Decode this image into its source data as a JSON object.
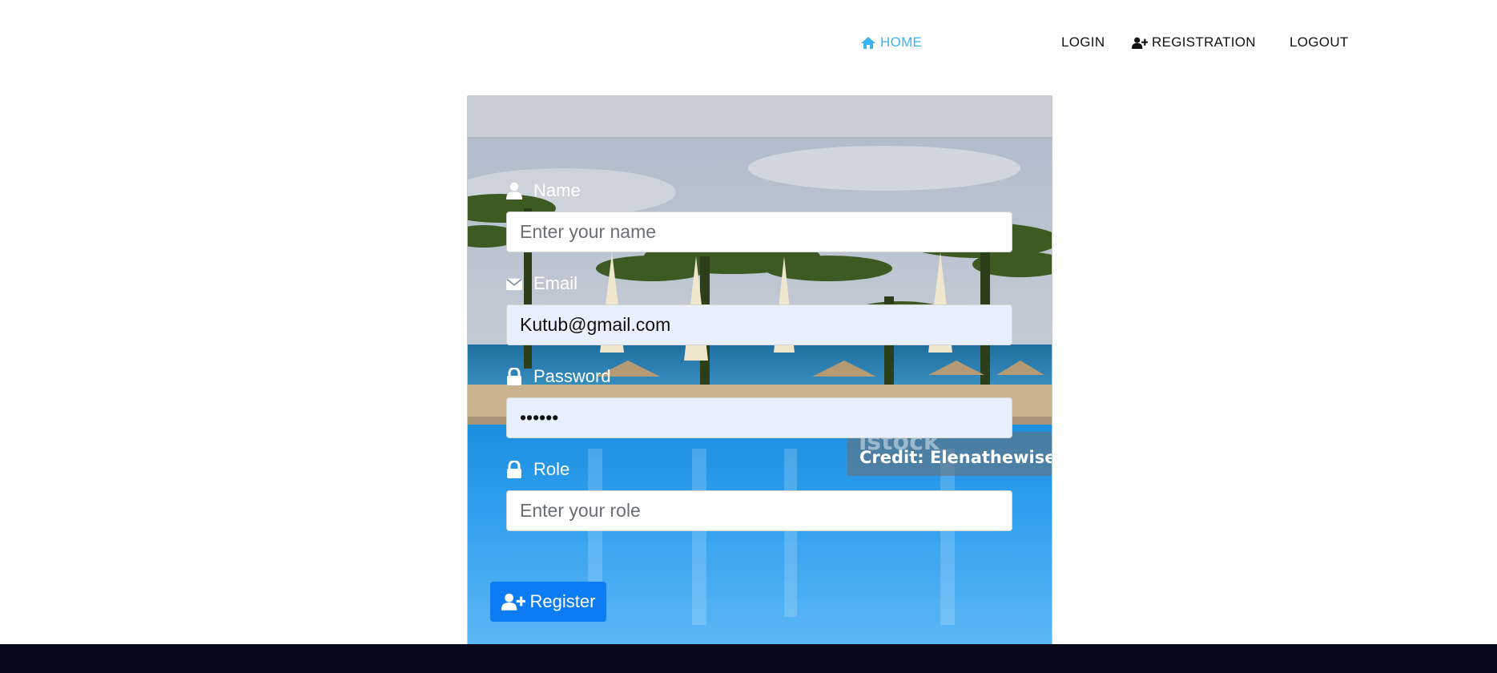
{
  "nav": {
    "home": "HOME",
    "login": "LOGIN",
    "registration": "REGISTRATION",
    "logout": "LOGOUT",
    "active_color": "#3bb3ef"
  },
  "form": {
    "name_label": "Name",
    "name_placeholder": "Enter your name",
    "email_label": "Email",
    "email_value": "Kutub@gmail.com",
    "password_label": "Password",
    "password_value": "••••••",
    "role_label": "Role",
    "role_placeholder": "Enter your role",
    "register_label": "Register"
  },
  "watermark": {
    "logo": "istock",
    "credit": "Credit: Elenathewise"
  },
  "icons": {
    "home": "home-icon",
    "registration": "user-plus-icon",
    "name": "user-icon",
    "email": "envelope-icon",
    "password": "lock-icon",
    "role": "lock-icon",
    "register": "user-plus-icon"
  },
  "colors": {
    "primary_button": "#0d7cf2",
    "footer": "#060718",
    "autofill": "#e8f0fe"
  }
}
